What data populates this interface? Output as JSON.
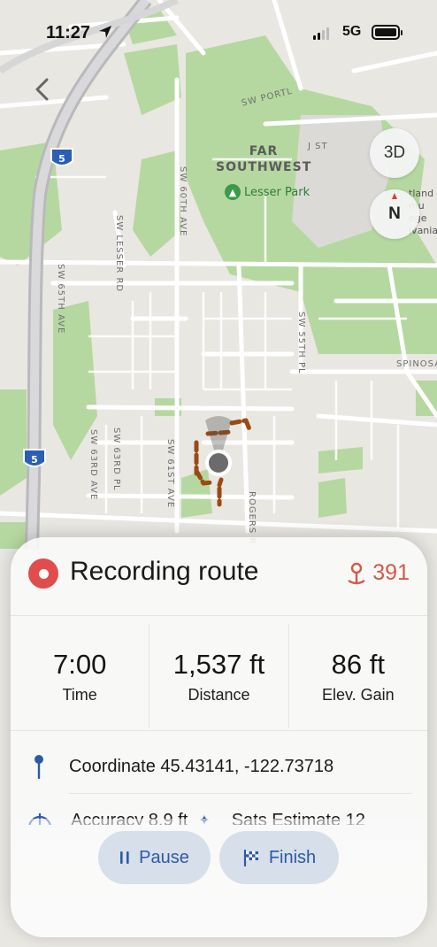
{
  "status_bar": {
    "time": "11:27",
    "network": "5G"
  },
  "map": {
    "place_label": "FAR\nSOUTHWEST",
    "park_label": "Lesser Park",
    "highway_shield": "5",
    "streets": {
      "sw_portland": "SW PORTL",
      "j_st": "J ST",
      "sw_60th": "SW 60TH AVE",
      "sw_lesser": "SW LESSER RD",
      "sw_65th": "SW 65TH AVE",
      "sw_55th": "SW 55TH PL",
      "spinosa": "SPINOSA",
      "sw_63rd_ave": "SW 63RD AVE",
      "sw_63rd_pl": "SW 63RD PL",
      "sw_61st": "SW 61ST AVE",
      "rogers": "ROGERS R"
    },
    "controls": {
      "three_d": "3D",
      "compass": "N"
    },
    "poi_fragments": [
      "tland",
      "mu",
      "ege",
      "lvania"
    ]
  },
  "recording": {
    "title": "Recording route",
    "point_count": "391",
    "stats": [
      {
        "value": "7:00",
        "label": "Time"
      },
      {
        "value": "1,537 ft",
        "label": "Distance"
      },
      {
        "value": "86 ft",
        "label": "Elev. Gain"
      }
    ],
    "coordinate": "Coordinate 45.43141, -122.73718",
    "accuracy": "Accuracy 8.9 ft",
    "sats": "Sats Estimate 12",
    "buttons": {
      "pause": "Pause",
      "finish": "Finish"
    }
  },
  "colors": {
    "accent": "#2d5aa8",
    "record": "#e14c4c",
    "track": "#9a4a12",
    "park": "#a6d18e"
  }
}
